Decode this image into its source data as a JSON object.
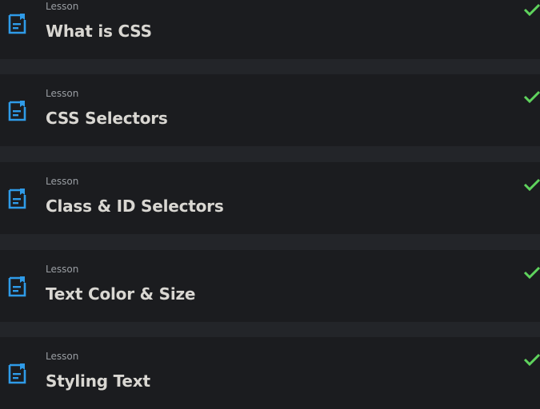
{
  "colors": {
    "page_background": "#232529",
    "row_background": "#1b1c1f",
    "icon_blue": "#2f9be8",
    "check_green": "#5fd35d",
    "title_text": "#d9d7d2",
    "type_text": "#9a9ea3"
  },
  "lessons": [
    {
      "type": "Lesson",
      "title": "What is CSS",
      "icon": "document-icon",
      "status_icon": "check-icon",
      "completed": true
    },
    {
      "type": "Lesson",
      "title": "CSS Selectors",
      "icon": "document-icon",
      "status_icon": "check-icon",
      "completed": true
    },
    {
      "type": "Lesson",
      "title": "Class & ID Selectors",
      "icon": "document-icon",
      "status_icon": "check-icon",
      "completed": true
    },
    {
      "type": "Lesson",
      "title": "Text Color & Size",
      "icon": "document-icon",
      "status_icon": "check-icon",
      "completed": true
    },
    {
      "type": "Lesson",
      "title": "Styling Text",
      "icon": "document-icon",
      "status_icon": "check-icon",
      "completed": true
    }
  ]
}
